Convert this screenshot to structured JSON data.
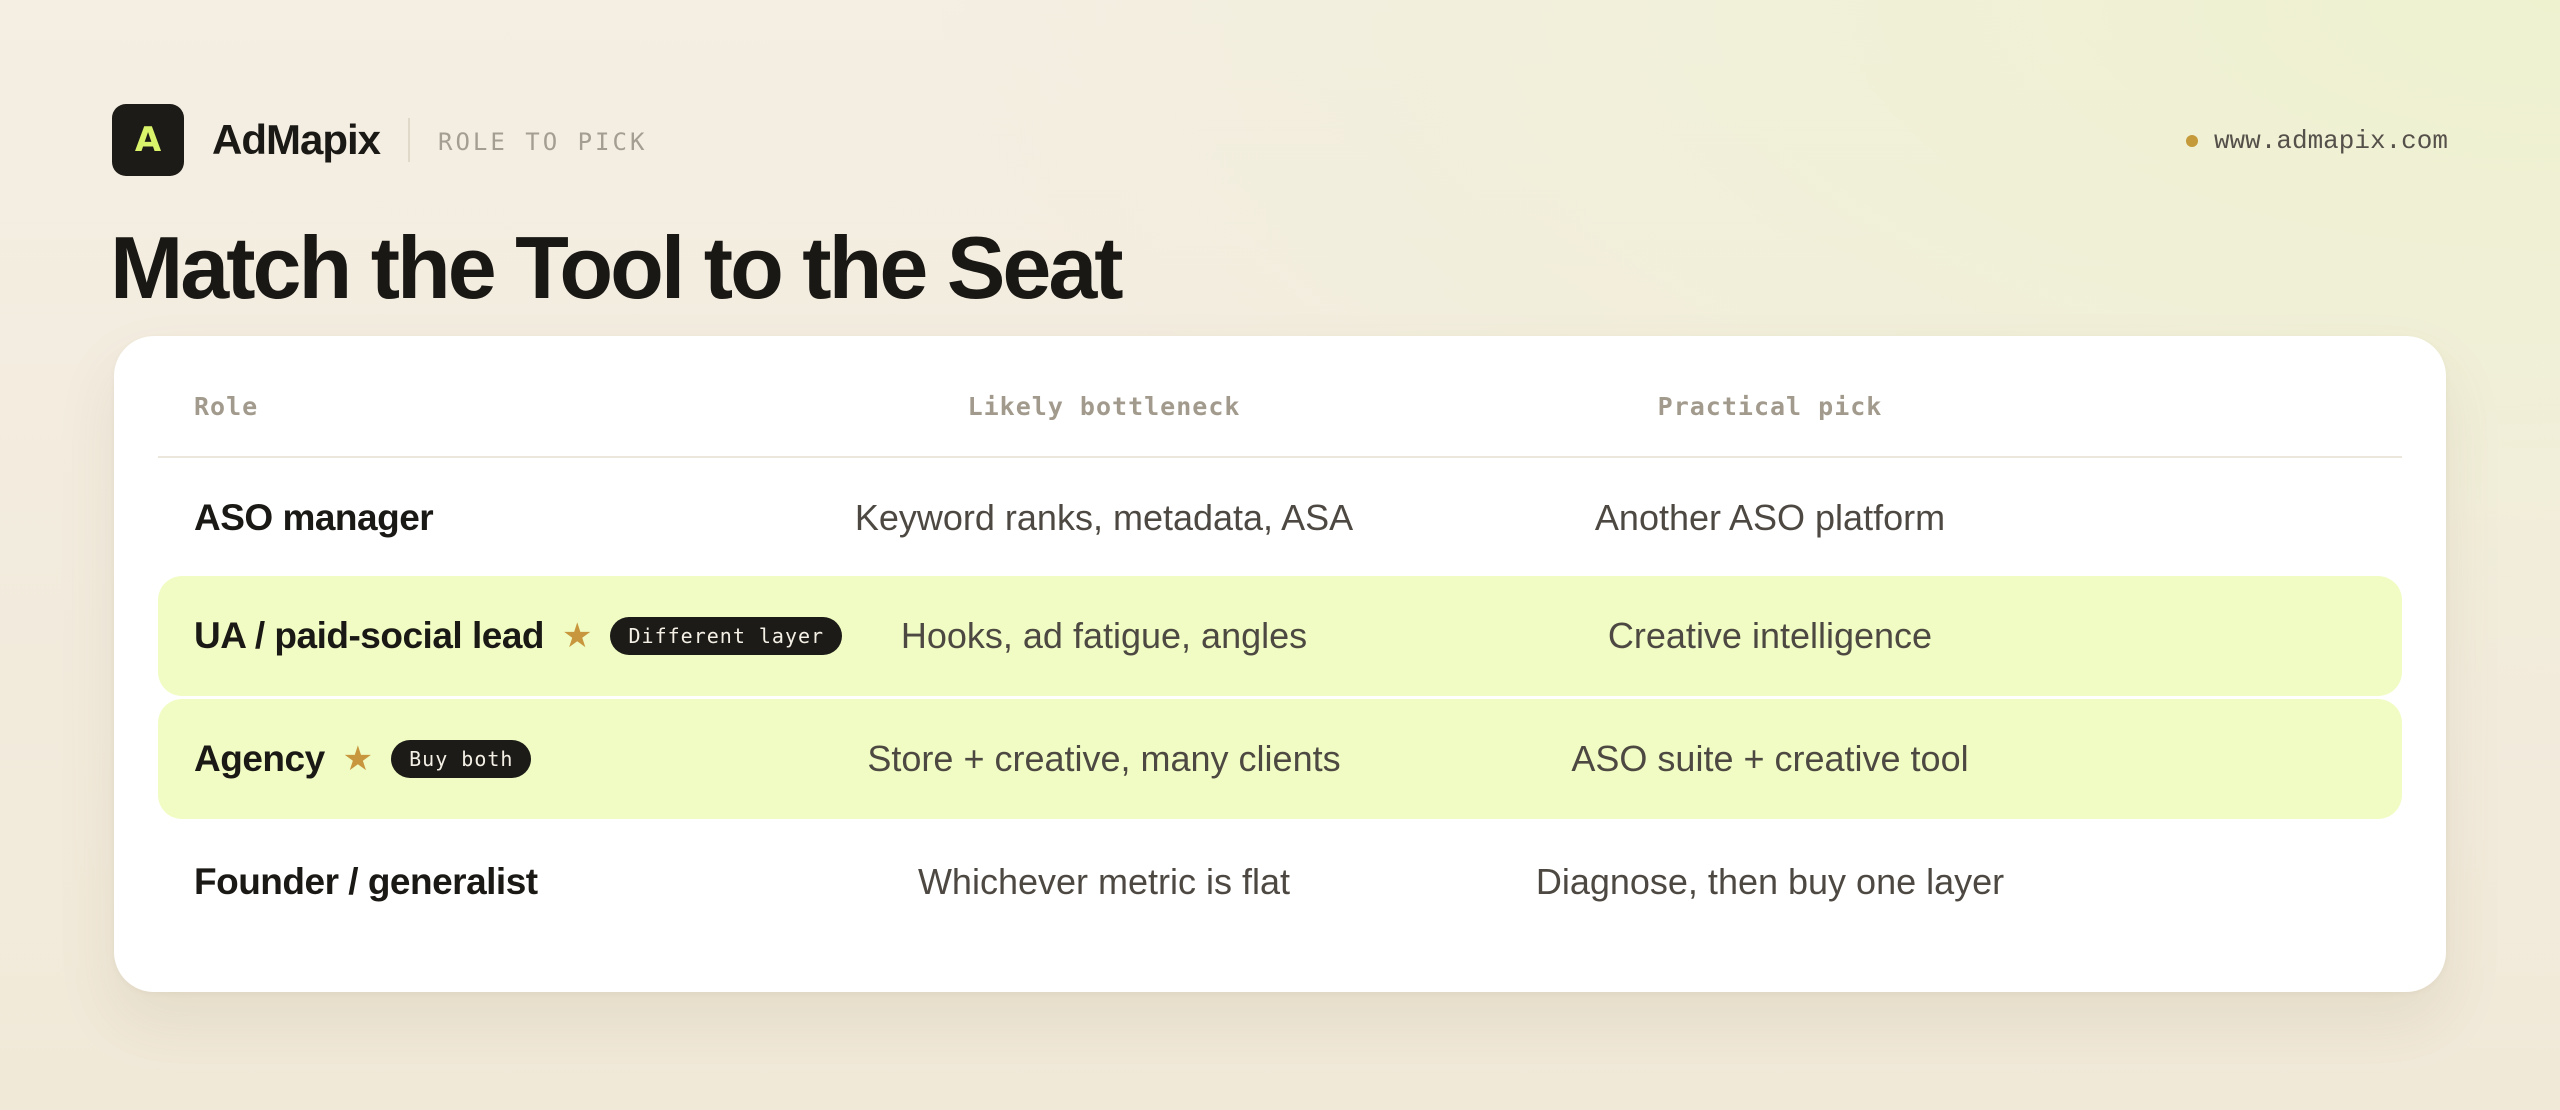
{
  "header": {
    "logo_letter": "A",
    "brand": "AdMapix",
    "eyebrow": "ROLE TO PICK",
    "site_url": "www.admapix.com"
  },
  "title": "Match the Tool to the Seat",
  "table": {
    "columns": [
      "Role",
      "Likely bottleneck",
      "Practical pick"
    ],
    "rows": [
      {
        "role": "ASO manager",
        "starred": false,
        "tag": "",
        "bottleneck": "Keyword ranks, metadata, ASA",
        "pick": "Another ASO platform"
      },
      {
        "role": "UA / paid-social lead",
        "starred": true,
        "tag": "Different layer",
        "bottleneck": "Hooks, ad fatigue, angles",
        "pick": "Creative intelligence"
      },
      {
        "role": "Agency",
        "starred": true,
        "tag": "Buy both",
        "bottleneck": "Store + creative, many clients",
        "pick": "ASO suite + creative tool"
      },
      {
        "role": "Founder / generalist",
        "starred": false,
        "tag": "",
        "bottleneck": "Whichever metric is flat",
        "pick": "Diagnose, then buy one layer"
      }
    ]
  },
  "colors": {
    "highlight": "#f0fcc3",
    "accent_star": "#c8963c",
    "logo_letter": "#d9f36a"
  },
  "icons": {
    "star": "star-icon",
    "dot": "status-dot-icon"
  }
}
